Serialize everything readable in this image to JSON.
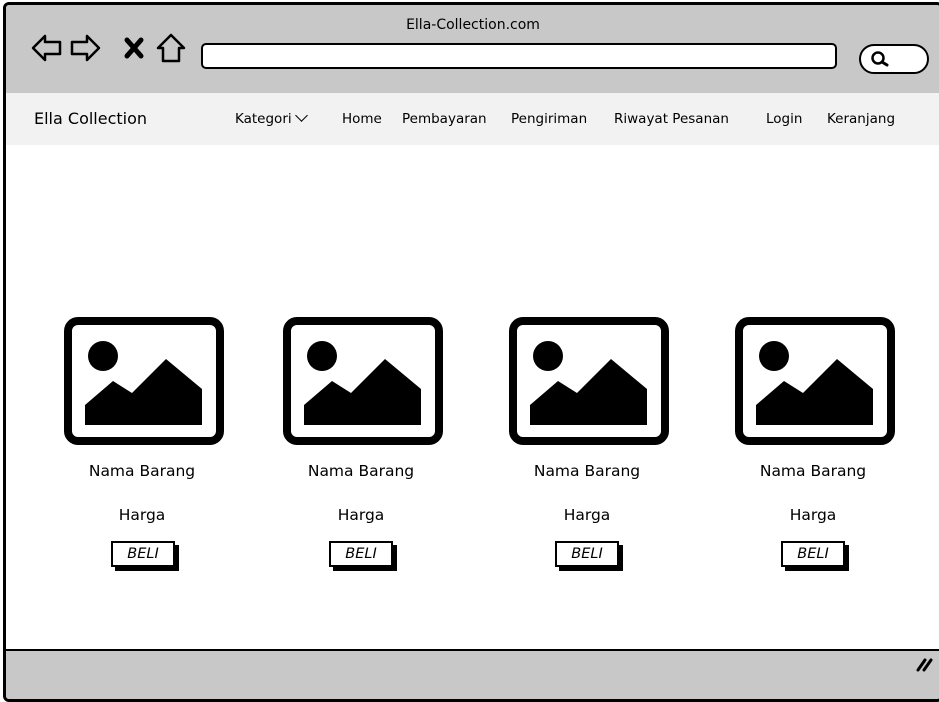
{
  "window": {
    "title": "Ella-Collection.com",
    "url": ""
  },
  "nav_icons": [
    "back-arrow-icon",
    "forward-arrow-icon",
    "close-x-icon",
    "home-icon"
  ],
  "menubar": {
    "brand": "Ella Collection",
    "items": [
      {
        "label": "Kategori",
        "dropdown": true
      },
      {
        "label": "Home"
      },
      {
        "label": "Pembayaran"
      },
      {
        "label": "Pengiriman"
      },
      {
        "label": "Riwayat Pesanan"
      },
      {
        "label": "Login"
      },
      {
        "label": "Keranjang"
      }
    ]
  },
  "products": [
    {
      "name": "Nama Barang",
      "price": "Harga",
      "buy_label": "BELI"
    },
    {
      "name": "Nama Barang",
      "price": "Harga",
      "buy_label": "BELI"
    },
    {
      "name": "Nama Barang",
      "price": "Harga",
      "buy_label": "BELI"
    },
    {
      "name": "Nama Barang",
      "price": "Harga",
      "buy_label": "BELI"
    }
  ],
  "colors": {
    "chrome": "#c8c8c8",
    "menubar": "#f2f2f2",
    "ink": "#000000"
  }
}
